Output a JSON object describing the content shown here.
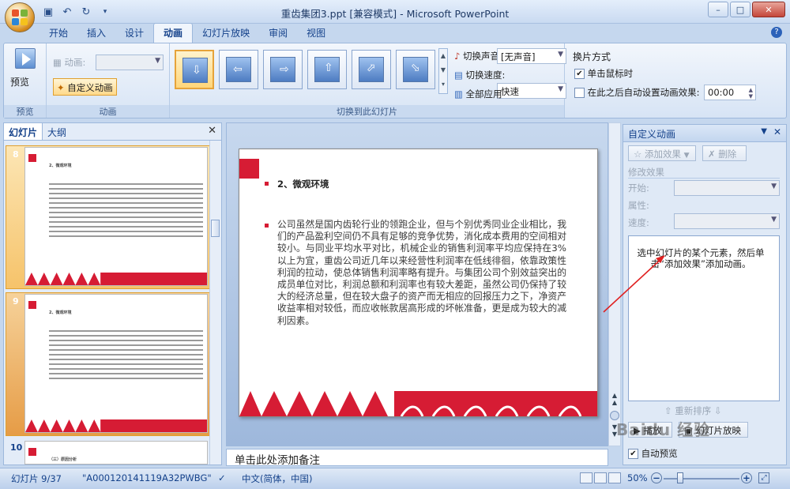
{
  "window": {
    "title": "重齿集团3.ppt [兼容模式] - Microsoft PowerPoint",
    "minimize": "–",
    "maximize": "□",
    "close": "✕"
  },
  "ribbon_tabs": [
    {
      "label": "开始"
    },
    {
      "label": "插入"
    },
    {
      "label": "设计"
    },
    {
      "label": "动画",
      "active": true
    },
    {
      "label": "幻灯片放映"
    },
    {
      "label": "审阅"
    },
    {
      "label": "视图"
    }
  ],
  "groups": {
    "preview": {
      "button": "预览",
      "label": "预览"
    },
    "animation": {
      "anim_label": "动画:",
      "custom_anim": "自定义动画",
      "label": "动画"
    },
    "transition": {
      "sound_label": "切换声音:",
      "sound_value": "[无声音]",
      "speed_label": "切换速度:",
      "speed_value": "快速",
      "apply_all": "全部应用",
      "label": "切换到此幻灯片",
      "selected_index": 0
    },
    "advance": {
      "title": "换片方式",
      "on_click": "单击鼠标时",
      "on_click_checked": true,
      "auto": "在此之后自动设置动画效果:",
      "auto_checked": false,
      "time": "00:00"
    }
  },
  "left_pane": {
    "tabs": [
      "幻灯片",
      "大纲"
    ],
    "close": "✕",
    "slides": [
      {
        "num": "8",
        "heading": "2、微观环境",
        "selected": false
      },
      {
        "num": "9",
        "heading": "2、微观环境",
        "selected": true
      },
      {
        "num": "10",
        "heading": "（三）原因分析",
        "selected": false
      }
    ]
  },
  "slide": {
    "heading": "2、微观环境",
    "body": "公司虽然是国内齿轮行业的领跑企业，但与个别优秀同业企业相比，我们的产品盈利空间仍不具有足够的竞争优势，消化成本费用的空间相对较小。与同业平均水平对比，机械企业的销售利润率平均应保持在3%以上为宜，重齿公司近几年以来经营性利润率在低线徘徊，依靠政策性利润的拉动，使总体销售利润率略有提升。与集团公司个别效益突出的成员单位对比，利润总额和利润率也有较大差距，虽然公司仍保持了较大的经济总量，但在较大盘子的资产而无相应的回报压力之下，净资产收益率相对较低，而应收帐款居高形成的坏帐准备，更是成为较大的减利因素。"
  },
  "notes": {
    "placeholder": "单击此处添加备注"
  },
  "task_pane": {
    "title": "自定义动画",
    "add_effect": "添加效果",
    "remove": "删除",
    "modify_title": "修改效果",
    "start_label": "开始:",
    "property_label": "属性:",
    "speed_label": "速度:",
    "hint": "选中幻灯片的某个元素，然后单击“添加效果”添加动画。",
    "reorder": "重新排序",
    "play": "播放",
    "slideshow": "幻灯片放映",
    "auto_preview": "自动预览",
    "auto_preview_checked": true
  },
  "status_bar": {
    "slide_info": "幻灯片 9/37",
    "theme": "\"A000120141119A32PWBG\"",
    "language": "中文(简体，中国)",
    "zoom": "50%",
    "zoom_fraction": 0.5
  },
  "watermark": "Baidu 经验",
  "colors": {
    "accent_red": "#d61c34",
    "ribbon_blue": "#15428b",
    "selection_orange": "#f6c36a"
  }
}
